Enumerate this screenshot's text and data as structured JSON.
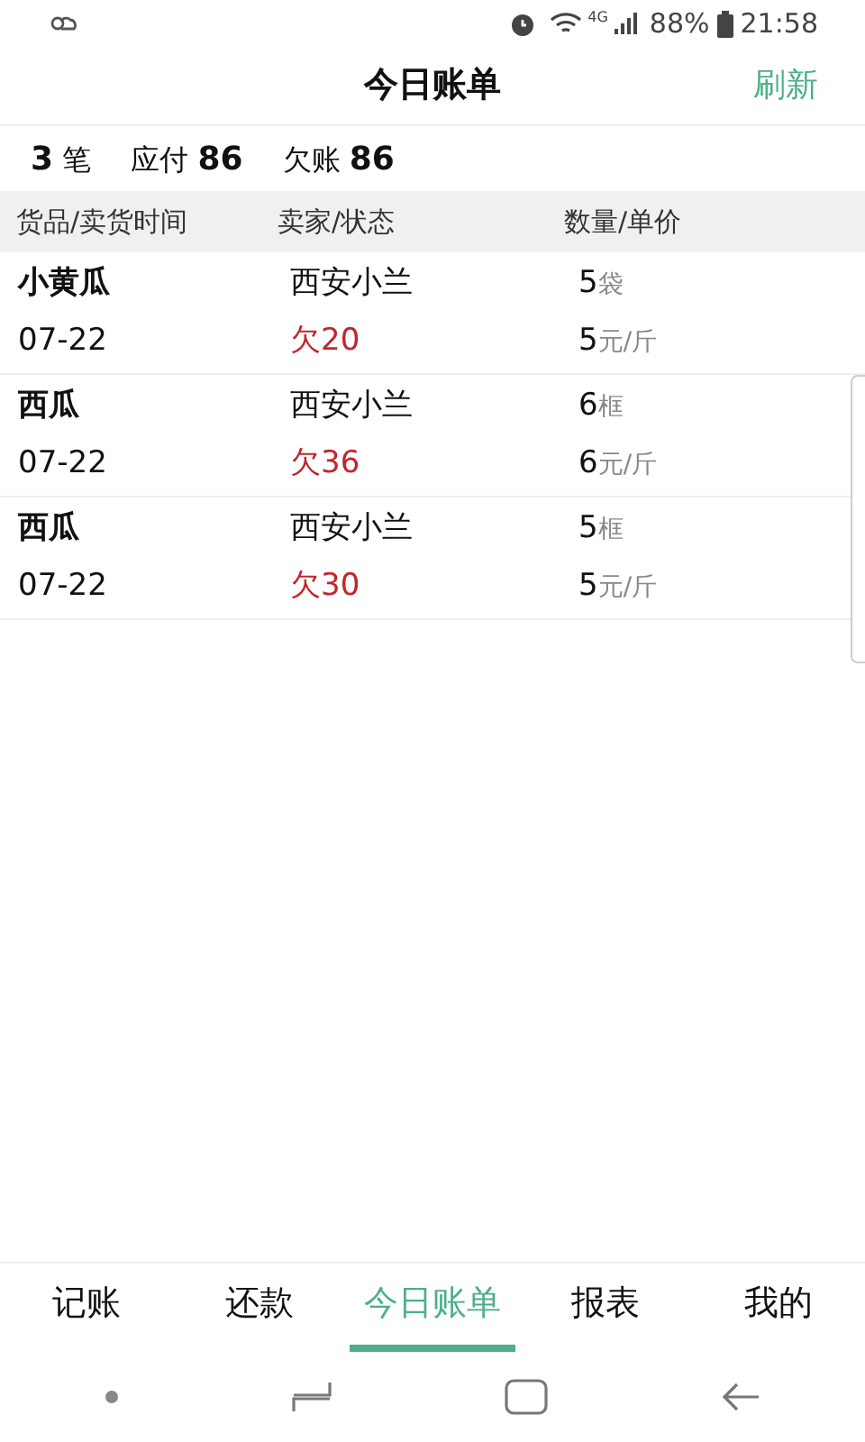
{
  "status_bar": {
    "network": "4G",
    "battery": "88%",
    "time": "21:58"
  },
  "header": {
    "title": "今日账单",
    "action": "刷新"
  },
  "summary": [
    {
      "kind": "count",
      "value": "3",
      "label": "笔"
    },
    {
      "kind": "amount",
      "label": "应付",
      "value": "86"
    },
    {
      "kind": "amount",
      "label": "欠账",
      "value": "86"
    }
  ],
  "table": {
    "columns": [
      "货品/卖货时间",
      "卖家/状态",
      "数量/单价"
    ],
    "rows": [
      {
        "name": "小黄瓜",
        "date": "07-22",
        "seller": "西安小兰",
        "status": "欠20",
        "quantity": "5",
        "quantity_unit": "袋",
        "price": "5",
        "price_unit": "元/斤"
      },
      {
        "name": "西瓜",
        "date": "07-22",
        "seller": "西安小兰",
        "status": "欠36",
        "quantity": "6",
        "quantity_unit": "框",
        "price": "6",
        "price_unit": "元/斤"
      },
      {
        "name": "西瓜",
        "date": "07-22",
        "seller": "西安小兰",
        "status": "欠30",
        "quantity": "5",
        "quantity_unit": "框",
        "price": "5",
        "price_unit": "元/斤"
      }
    ]
  },
  "tabs": [
    {
      "label": "记账",
      "selected": false
    },
    {
      "label": "还款",
      "selected": false
    },
    {
      "label": "今日账单",
      "selected": true
    },
    {
      "label": "报表",
      "selected": false
    },
    {
      "label": "我的",
      "selected": false
    }
  ]
}
